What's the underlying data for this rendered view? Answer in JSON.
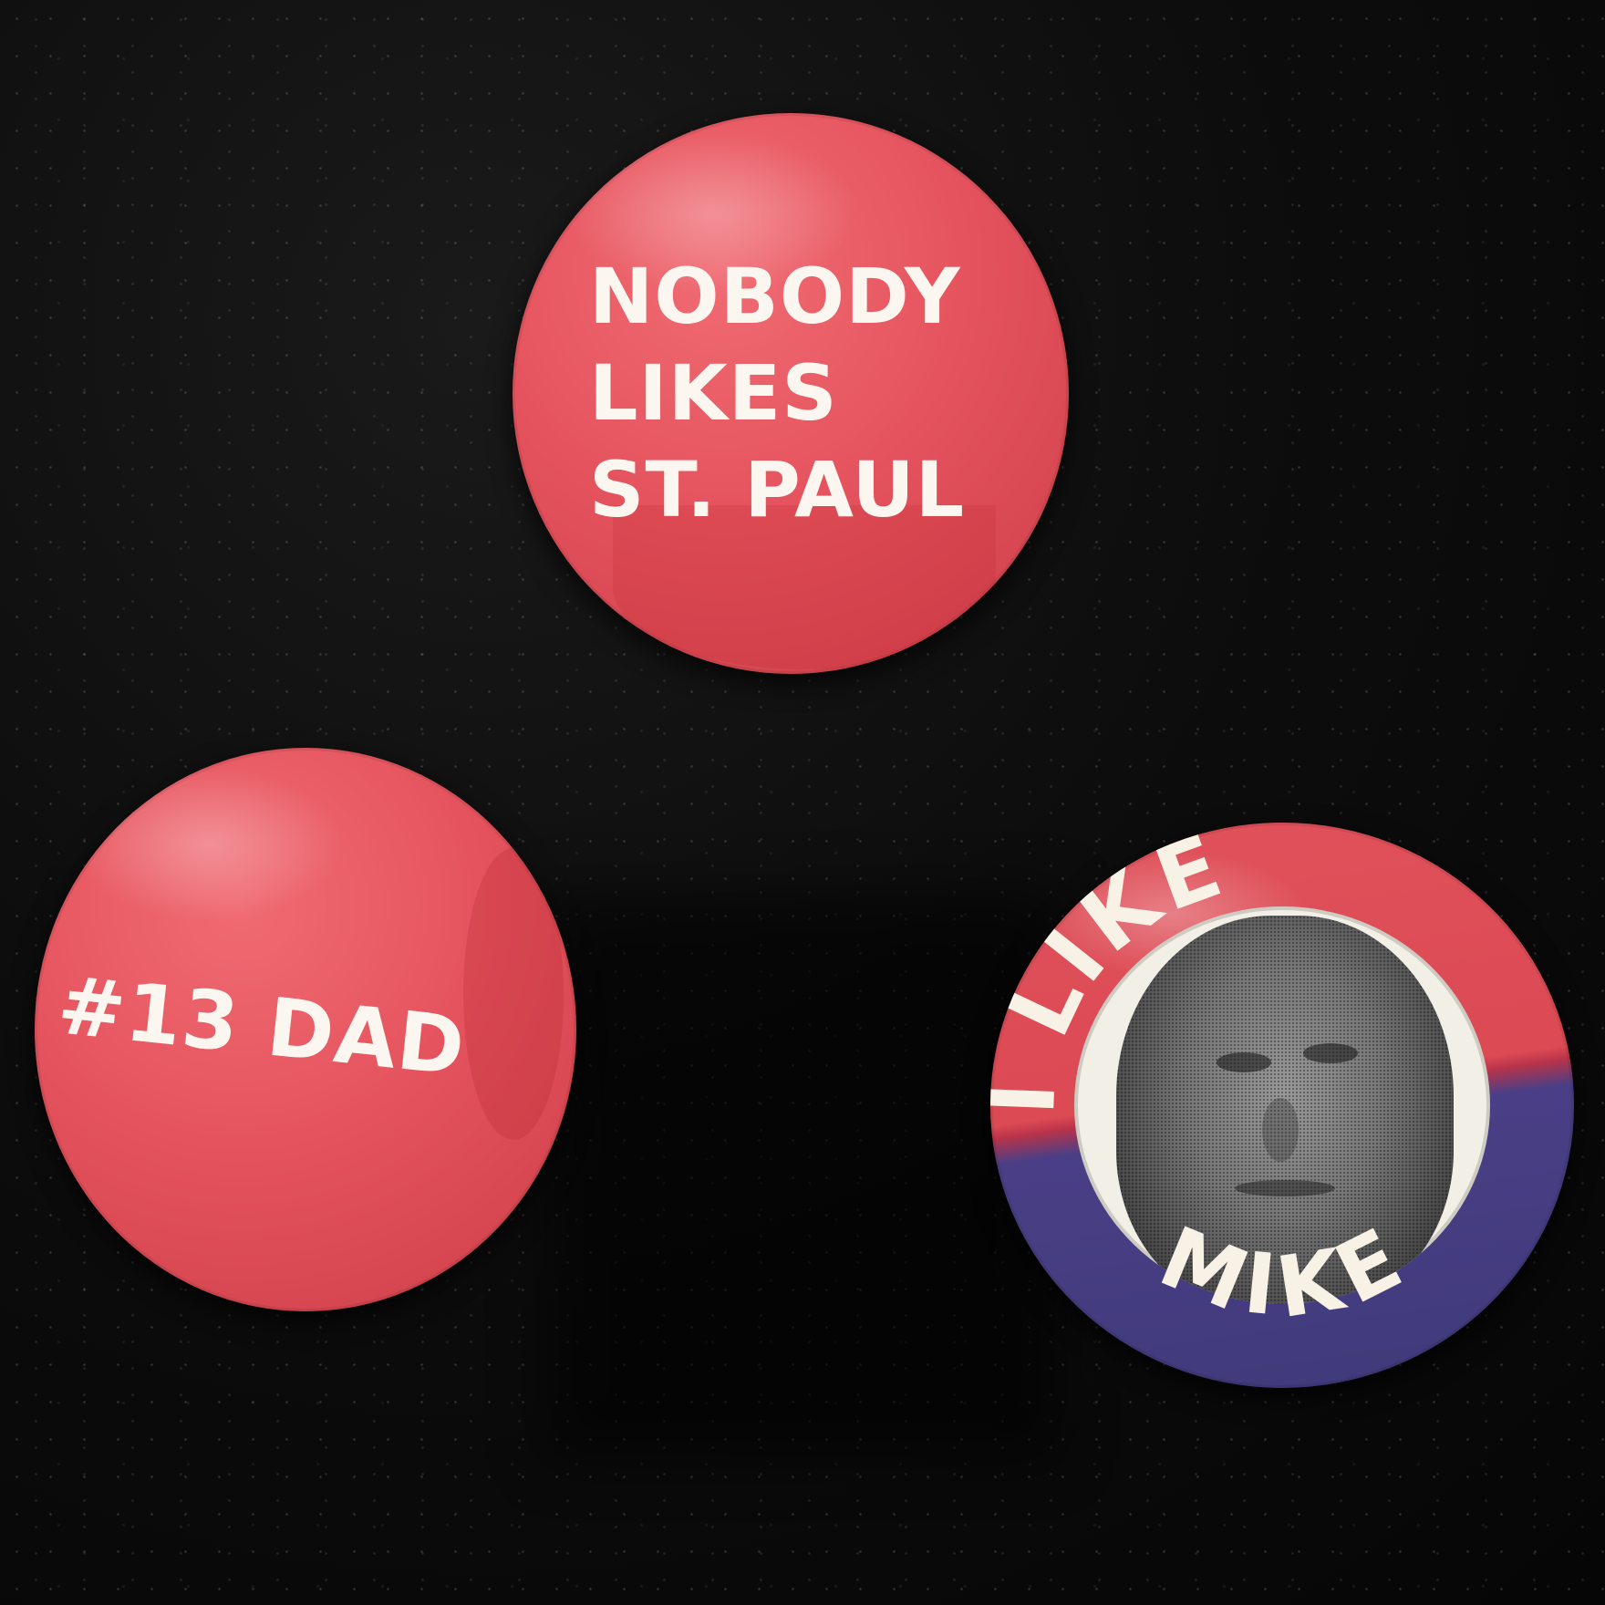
{
  "scene": {
    "background": "black speckled granite surface"
  },
  "buttons": [
    {
      "id": "nobody-likes-st-paul",
      "color": "#e0505a",
      "text_lines": [
        "NOBODY",
        "LIKES",
        "ST. PAUL"
      ]
    },
    {
      "id": "number-13-dad",
      "color": "#e0505a",
      "text": "#13 DAD"
    },
    {
      "id": "i-like-mike",
      "colors": {
        "top": "#dc4a54",
        "bottom": "#3f3a7a",
        "center": "#f2efe6"
      },
      "top_text": "I LIKE",
      "bottom_text": "MIKE"
    }
  ]
}
